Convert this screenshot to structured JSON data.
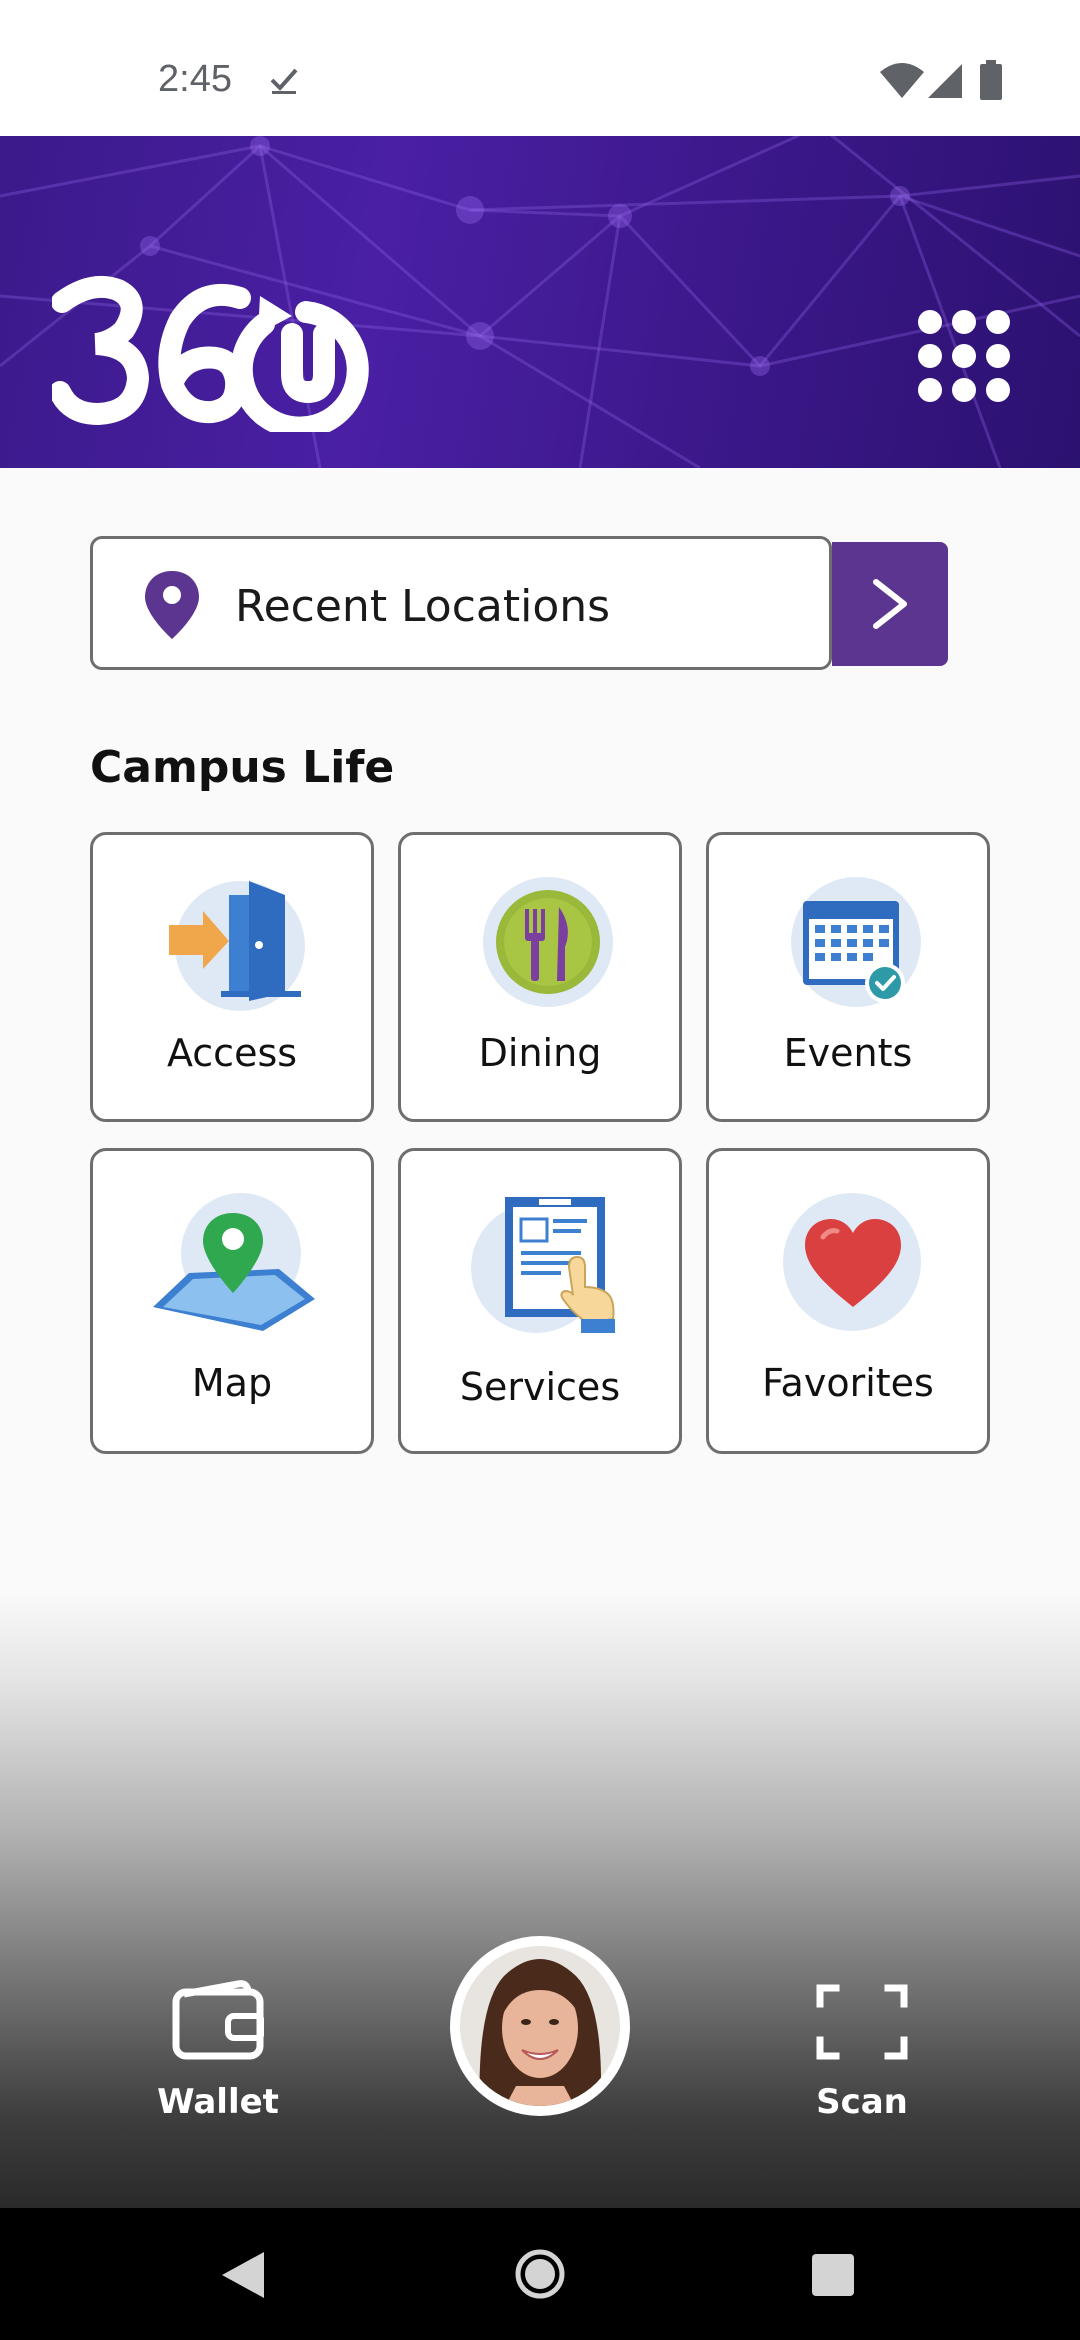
{
  "status_bar": {
    "time": "2:45"
  },
  "header": {
    "logo_text": "360U",
    "menu_icon": "apps-grid-icon"
  },
  "recent_locations": {
    "label": "Recent Locations",
    "icon": "location-pin-icon",
    "go_icon": "chevron-right-icon"
  },
  "campus_life": {
    "title": "Campus Life",
    "tiles": [
      {
        "label": "Access",
        "icon": "door-entry-icon"
      },
      {
        "label": "Dining",
        "icon": "fork-knife-icon"
      },
      {
        "label": "Events",
        "icon": "calendar-check-icon"
      },
      {
        "label": "Map",
        "icon": "map-pin-icon"
      },
      {
        "label": "Services",
        "icon": "clipboard-hand-icon"
      },
      {
        "label": "Favorites",
        "icon": "heart-icon"
      }
    ]
  },
  "bottom_nav": {
    "wallet_label": "Wallet",
    "scan_label": "Scan",
    "avatar": "profile-photo"
  },
  "colors": {
    "brand_purple": "#4a1fa4",
    "button_purple": "#5b3590",
    "pin_purple": "#5b3590"
  }
}
